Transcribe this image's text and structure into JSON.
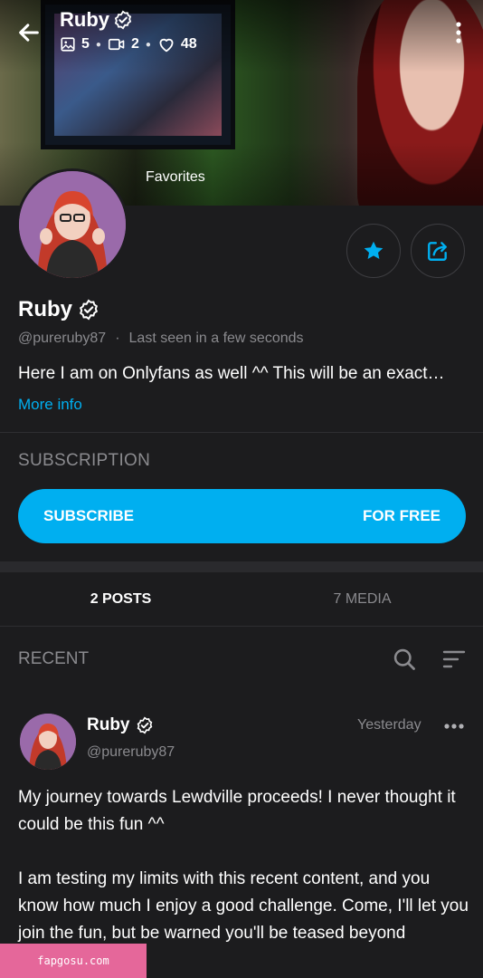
{
  "header": {
    "name": "Ruby",
    "stats": {
      "photos": "5",
      "videos": "2",
      "likes": "48"
    },
    "cover_label": "Favorites"
  },
  "profile": {
    "name": "Ruby",
    "handle": "@pureruby87",
    "separator": "·",
    "last_seen": "Last seen in a few seconds",
    "bio": "Here I am on Onlyfans as well ^^ This will be an exact…",
    "more_info": "More info"
  },
  "subscription": {
    "heading": "SUBSCRIPTION",
    "button_left": "SUBSCRIBE",
    "button_right": "FOR FREE"
  },
  "tabs": [
    {
      "label": "2 POSTS",
      "active": true
    },
    {
      "label": "7 MEDIA",
      "active": false
    }
  ],
  "feed": {
    "heading": "RECENT"
  },
  "post": {
    "name": "Ruby",
    "handle": "@pureruby87",
    "time": "Yesterday",
    "paragraphs": [
      "My journey towards Lewdville proceeds! I never thought it could be this fun ^^",
      "I am testing my limits with this recent content, and you know how much I enjoy a good challenge. Come, I'll let you join the fun, but be warned you'll be teased beyond"
    ]
  },
  "watermark": "fapgosu.com",
  "colors": {
    "accent": "#00aff0",
    "background": "#1c1c1e",
    "muted_text": "#8a8a8e",
    "watermark_bg": "#e5679a"
  },
  "icons": {
    "back": "arrow-left-icon",
    "photos": "image-icon",
    "videos": "video-icon",
    "likes": "heart-icon",
    "menu": "kebab-vertical-icon",
    "verified": "verified-badge-icon",
    "favorite": "star-icon",
    "share": "share-icon",
    "search": "search-icon",
    "sort": "sort-icon",
    "post_menu": "kebab-horizontal-icon"
  }
}
